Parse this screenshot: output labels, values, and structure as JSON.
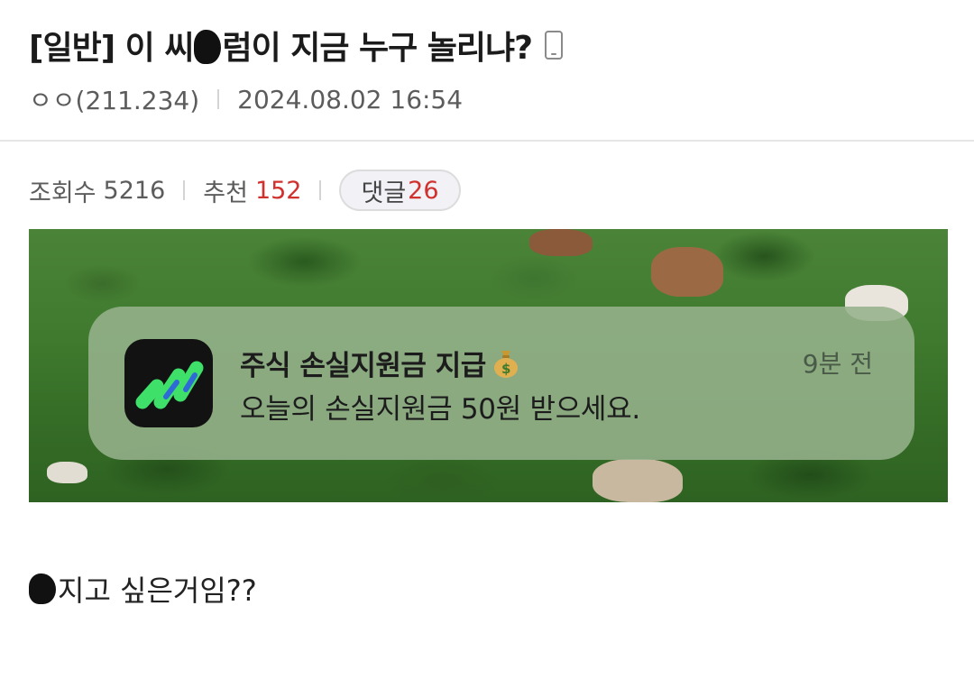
{
  "post": {
    "title_before": "[일반] 이 씨",
    "title_after": "럼이 지금 누구 놀리냐?",
    "author": "ㅇㅇ(211.234)",
    "date": "2024.08.02 16:54",
    "views_label": "조회수",
    "views": "5216",
    "recommend_label": "추천",
    "recommend": "152",
    "comments_label": "댓글",
    "comments": "26",
    "body_text": "지고 싶은거임??"
  },
  "notification": {
    "title": "주식 손실지원금 지급",
    "time": "9분 전",
    "body": "오늘의 손실지원금 50원 받으세요.",
    "app_icon": "stock-app-icon",
    "emoji": "money-bag-icon"
  },
  "icons": {
    "device": "mobile-phone-icon"
  },
  "colors": {
    "accent_red": "#d0312d",
    "redaction": "#111111",
    "app_icon_green": "#3ee06a"
  }
}
